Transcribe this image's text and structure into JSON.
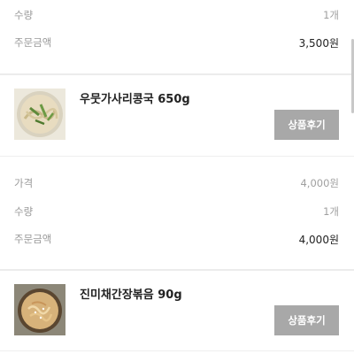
{
  "order_prev": {
    "quantity_label": "수량",
    "quantity_value": "1개",
    "total_label": "주문금액",
    "total_value": "3,500원"
  },
  "item1": {
    "name": "우뭇가사리콩국 650g",
    "review_button": "상품후기",
    "thumb_icon": "soybean-noodle-soup-image",
    "price_label": "가격",
    "price_value": "4,000원",
    "quantity_label": "수량",
    "quantity_value": "1개",
    "total_label": "주문금액",
    "total_value": "4,000원"
  },
  "item2": {
    "name": "진미채간장볶음 90g",
    "review_button": "상품후기",
    "thumb_icon": "stir-fried-squid-image"
  },
  "colors": {
    "button_bg": "#a8a8a8",
    "label_gray": "#9a9a9a",
    "divider": "#ececec"
  }
}
